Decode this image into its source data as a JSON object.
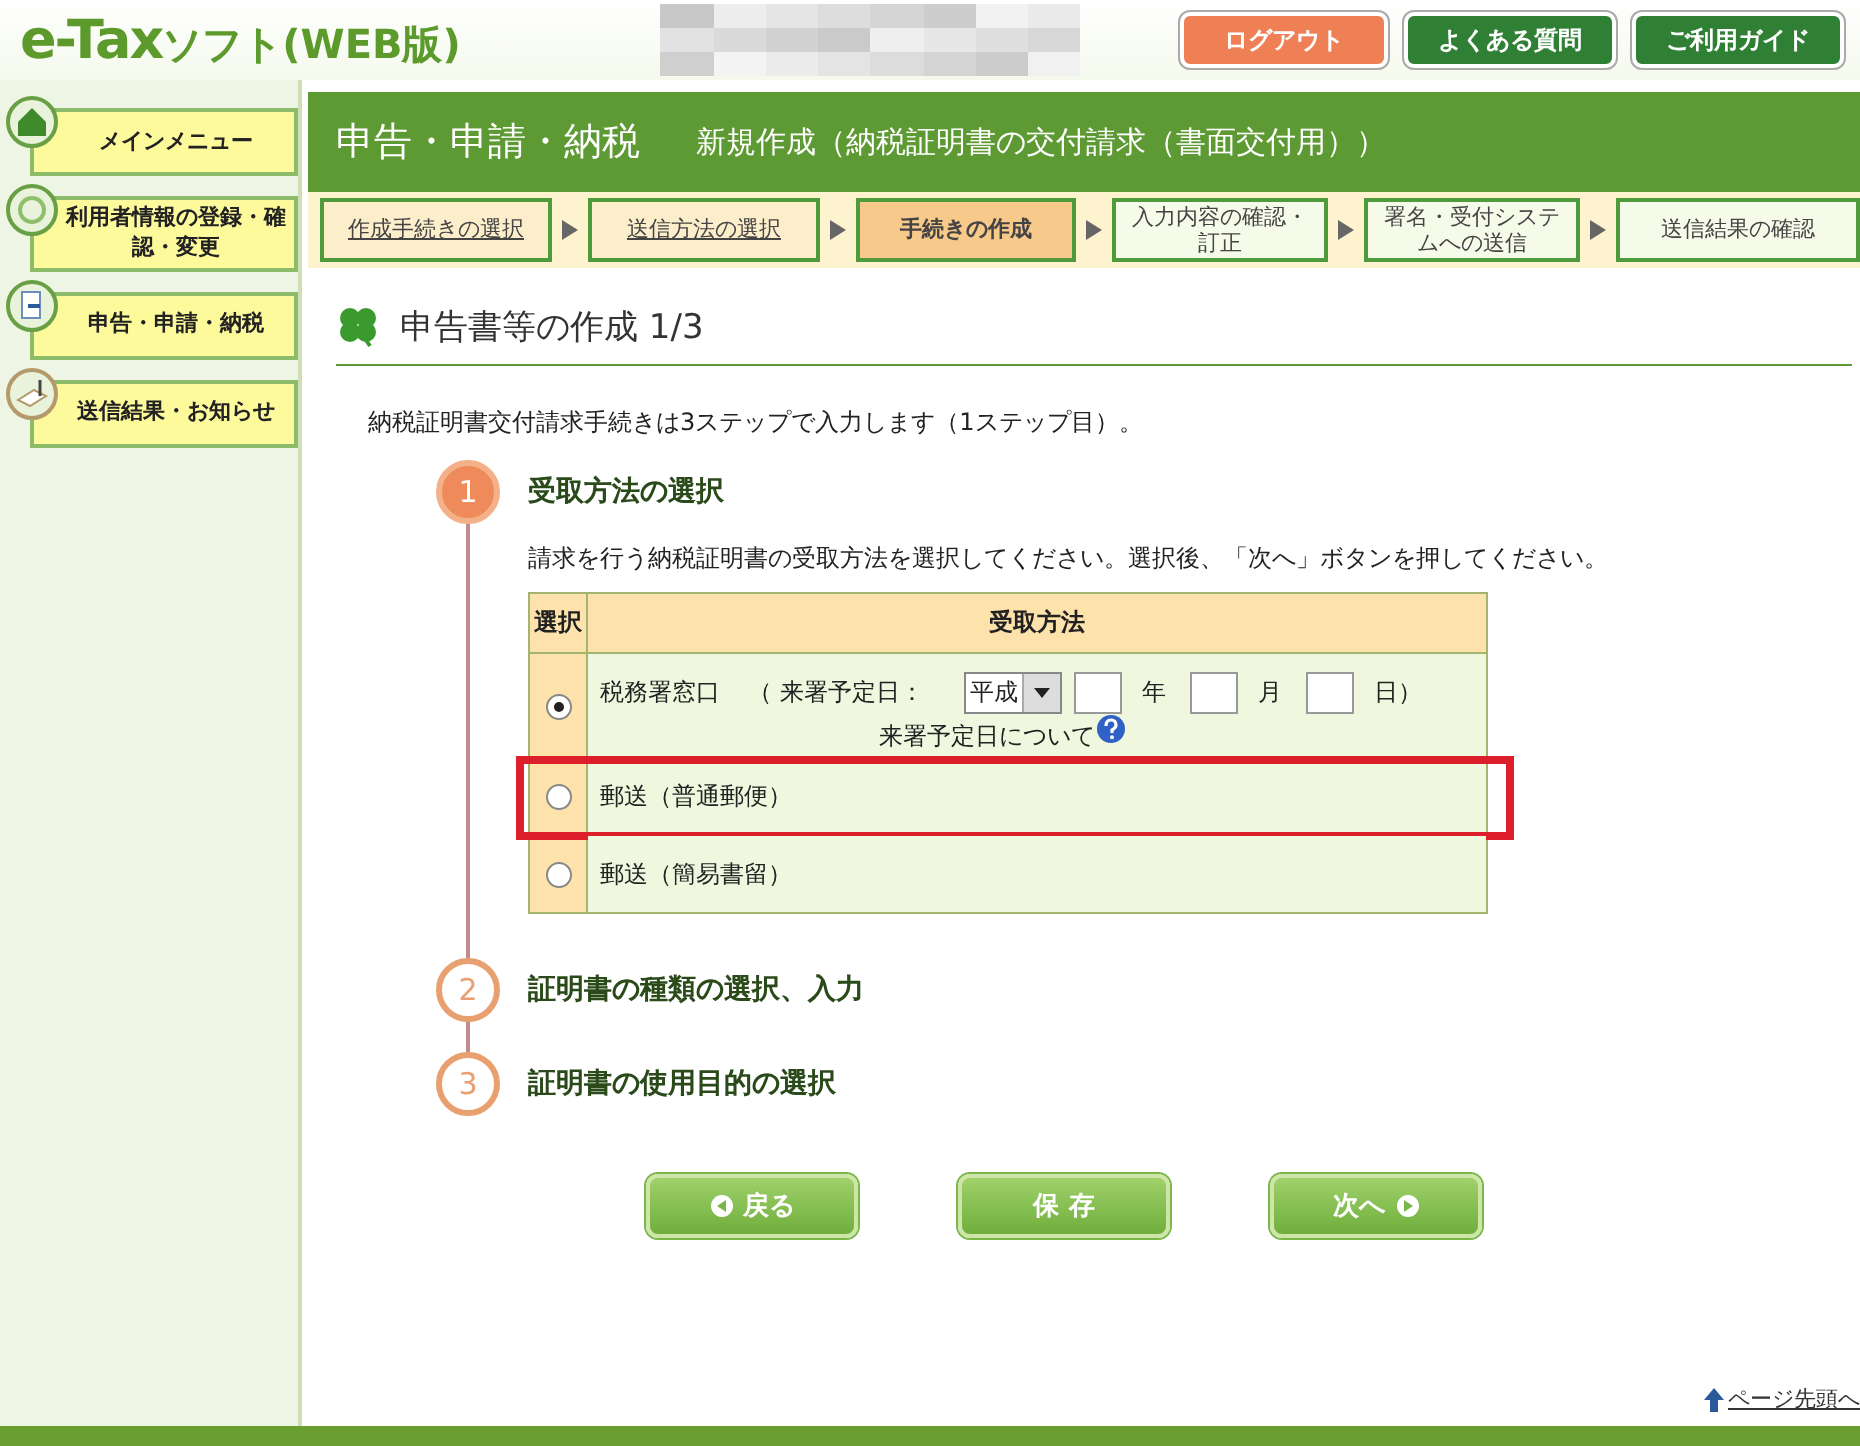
{
  "header": {
    "logo": "e-Tax",
    "logo_suffix": "ソフト(WEB版)",
    "buttons": [
      {
        "label": "ログアウト",
        "kind": "logout"
      },
      {
        "label": "よくある質問",
        "kind": "link"
      },
      {
        "label": "ご利用ガイド",
        "kind": "link"
      }
    ]
  },
  "sidebar": {
    "items": [
      {
        "label": "メインメニュー",
        "kind": "home"
      },
      {
        "label": "利用者情報の登録・確認・変更",
        "kind": "target"
      },
      {
        "label": "申告・申請・納税",
        "kind": "document"
      },
      {
        "label": "送信結果・お知らせ",
        "kind": "mail"
      }
    ]
  },
  "title_bar": {
    "section": "申告・申請・納税",
    "subtitle": "新規作成（納税証明書の交付請求（書面交付用））"
  },
  "steps_bar": [
    {
      "label": "作成手続きの選択",
      "completed": true,
      "selected": false
    },
    {
      "label": "送信方法の選択",
      "completed": true,
      "selected": false
    },
    {
      "label": "手続きの作成",
      "completed": false,
      "selected": true
    },
    {
      "label": "入力内容の確認・訂正",
      "completed": false,
      "selected": false
    },
    {
      "label": "署名・受付システムへの送信",
      "completed": false,
      "selected": false
    },
    {
      "label": "送信結果の確認",
      "completed": false,
      "selected": false
    }
  ],
  "heading": "申告書等の作成 1/3",
  "intro": "納税証明書交付請求手続きは3ステップで入力します（1ステップ目）。",
  "steps": [
    {
      "number": "1",
      "title": "受取方法の選択",
      "active": true,
      "instruction": "請求を行う納税証明書の受取方法を選択してください。選択後、「次へ」ボタンを押してください。",
      "table": {
        "columns": [
          "選択",
          "受取方法"
        ],
        "rows": [
          {
            "kind": "date",
            "label": "税務署窓口",
            "selected": true,
            "date_prefix": "（ 来署予定日：",
            "era": "平成",
            "units": [
              "年",
              "月",
              "日）"
            ],
            "note": "来署予定日について"
          },
          {
            "kind": "plain",
            "label": "郵送（普通郵便）",
            "selected": false,
            "highlighted": true
          },
          {
            "kind": "plain",
            "label": "郵送（簡易書留）",
            "selected": false
          }
        ]
      }
    },
    {
      "number": "2",
      "title": "証明書の種類の選択、入力",
      "active": false
    },
    {
      "number": "3",
      "title": "証明書の使用目的の選択",
      "active": false
    }
  ],
  "buttons": [
    {
      "label": "戻る",
      "kind": "back"
    },
    {
      "label": "保 存",
      "kind": "save"
    },
    {
      "label": "次へ",
      "kind": "next"
    }
  ],
  "page_top": "ページ先頭へ"
}
